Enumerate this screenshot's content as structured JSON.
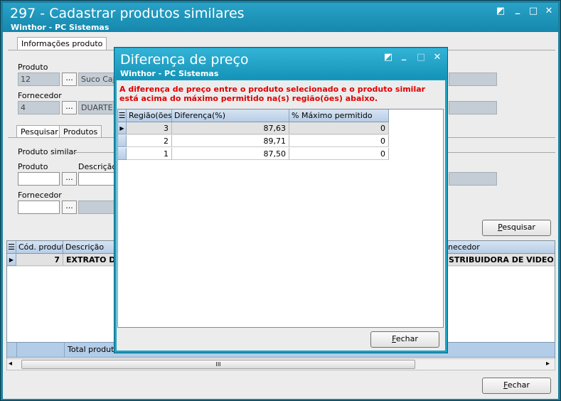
{
  "main_window": {
    "title": "297 - Cadastrar produtos similares",
    "subtitle": "Winthor - PC Sistemas",
    "tab_info": "Informações produto",
    "produto_label": "Produto",
    "produto_code": "12",
    "produto_desc": "Suco Cajú",
    "fornecedor_label": "Fornecedor",
    "fornecedor_code": "4",
    "fornecedor_desc": "DUARTE E",
    "dots": "...",
    "tab_pesquisar": "Pesquisar",
    "tab_produtos": "Produtos",
    "produto_similar_label": "Produto similar",
    "ps_produto_label": "Produto",
    "ps_descricao_label": "Descrição",
    "ps_fornecedor_label": "Fornecedor",
    "pesquisar_button_prefix": "P",
    "pesquisar_button_rest": "esquisar",
    "grid": {
      "col_codigo": "Cód. produt",
      "col_descricao": "Descrição",
      "col_fornecedor": "necedor",
      "row_codigo": "7",
      "row_descricao": "EXTRATO DE T",
      "row_fornecedor": "STRIBUIDORA DE VIDEO GA"
    },
    "total_label": "Total produto(",
    "scroll_thumb": "III",
    "fechar_prefix": "F",
    "fechar_rest": "echar"
  },
  "dialog": {
    "title": "Diferença de preço",
    "subtitle": "Winthor - PC Sistemas",
    "message_line1": "A diferença de preço entre o produto selecionado e o produto similar",
    "message_line2": "está acima do máximo permitido na(s) região(ões) abaixo.",
    "columns": [
      "Região(ões)",
      "Diferença(%)",
      "% Máximo permitido"
    ],
    "rows": [
      {
        "regiao": "3",
        "diferenca": "87,63",
        "maximo": "0"
      },
      {
        "regiao": "2",
        "diferenca": "89,71",
        "maximo": "0"
      },
      {
        "regiao": "1",
        "diferenca": "87,50",
        "maximo": "0"
      }
    ],
    "fechar_prefix": "F",
    "fechar_rest": "echar"
  },
  "icons": {
    "restore": "◩",
    "minimize": "_",
    "maximize": "□",
    "close": "✕",
    "row_pointer": "▶",
    "grid_menu": "☰",
    "scroll_left": "◂",
    "scroll_right": "▸"
  },
  "colors": {
    "titlebar": "#1688ad",
    "dialog_titlebar": "#1493b8",
    "warning_text": "#e00000",
    "readonly_field": "#c4cdd5"
  }
}
